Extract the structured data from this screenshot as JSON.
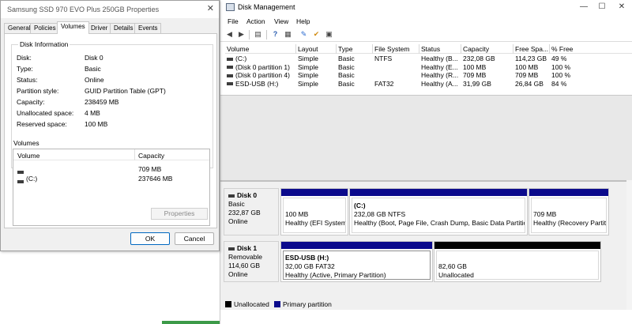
{
  "props": {
    "title": "Samsung SSD 970 EVO Plus 250GB Properties",
    "close": "✕",
    "tabs": [
      {
        "label": "General"
      },
      {
        "label": "Policies"
      },
      {
        "label": "Volumes",
        "active": true
      },
      {
        "label": "Driver"
      },
      {
        "label": "Details"
      },
      {
        "label": "Events"
      }
    ],
    "disk_info_title": "Disk Information",
    "info": [
      {
        "k": "Disk:",
        "v": "Disk 0"
      },
      {
        "k": "Type:",
        "v": "Basic"
      },
      {
        "k": "Status:",
        "v": "Online"
      },
      {
        "k": "Partition style:",
        "v": "GUID Partition Table (GPT)"
      },
      {
        "k": "Capacity:",
        "v": "238459 MB"
      },
      {
        "k": "Unallocated space:",
        "v": "4 MB"
      },
      {
        "k": "Reserved space:",
        "v": "100 MB"
      }
    ],
    "volumes_label": "Volumes",
    "vol_headers": {
      "volume": "Volume",
      "capacity": "Capacity"
    },
    "vol_rows": [
      {
        "volume": "",
        "capacity": "709 MB"
      },
      {
        "volume": "(C:)",
        "capacity": "237646 MB"
      }
    ],
    "properties_btn": "Properties",
    "ok": "OK",
    "cancel": "Cancel"
  },
  "dm": {
    "title": "Disk Management",
    "window_controls": {
      "minimize": "—",
      "maximize": "☐",
      "close": "✕"
    },
    "menu": [
      "File",
      "Action",
      "View",
      "Help"
    ],
    "columns": [
      "Volume",
      "Layout",
      "Type",
      "File System",
      "Status",
      "Capacity",
      "Free Spa...",
      "% Free"
    ],
    "volumes": [
      {
        "volume": "(C:)",
        "layout": "Simple",
        "type": "Basic",
        "fs": "NTFS",
        "status": "Healthy (B...",
        "capacity": "232,08 GB",
        "free": "114,23 GB",
        "pct": "49 %"
      },
      {
        "volume": "(Disk 0 partition 1)",
        "layout": "Simple",
        "type": "Basic",
        "fs": "",
        "status": "Healthy (E...",
        "capacity": "100 MB",
        "free": "100 MB",
        "pct": "100 %"
      },
      {
        "volume": "(Disk 0 partition 4)",
        "layout": "Simple",
        "type": "Basic",
        "fs": "",
        "status": "Healthy (R...",
        "capacity": "709 MB",
        "free": "709 MB",
        "pct": "100 %"
      },
      {
        "volume": "ESD-USB (H:)",
        "layout": "Simple",
        "type": "Basic",
        "fs": "FAT32",
        "status": "Healthy (A...",
        "capacity": "31,99 GB",
        "free": "26,84 GB",
        "pct": "84 %"
      }
    ],
    "disks": [
      {
        "name": "Disk 0",
        "type": "Basic",
        "size": "232,87 GB",
        "status": "Online",
        "partitions": [
          {
            "name": "",
            "size": "100 MB",
            "health": "Healthy (EFI System",
            "kind": "primary"
          },
          {
            "name": "(C:)",
            "size": "232,08 GB NTFS",
            "health": "Healthy (Boot, Page File, Crash Dump, Basic Data Partition)",
            "kind": "primary"
          },
          {
            "name": "",
            "size": "709 MB",
            "health": "Healthy (Recovery Partition)",
            "kind": "primary"
          }
        ]
      },
      {
        "name": "Disk 1",
        "type": "Removable",
        "size": "114,60 GB",
        "status": "Online",
        "partitions": [
          {
            "name": "ESD-USB  (H:)",
            "size": "32,00 GB FAT32",
            "health": "Healthy (Active, Primary Partition)",
            "kind": "primary"
          },
          {
            "name": "",
            "size": "82,60 GB",
            "health": "Unallocated",
            "kind": "unallocated"
          }
        ]
      }
    ],
    "legend": {
      "unallocated": "Unallocated",
      "primary": "Primary partition"
    },
    "colors": {
      "primary": "#0b0a8c",
      "unallocated": "#000000"
    }
  }
}
